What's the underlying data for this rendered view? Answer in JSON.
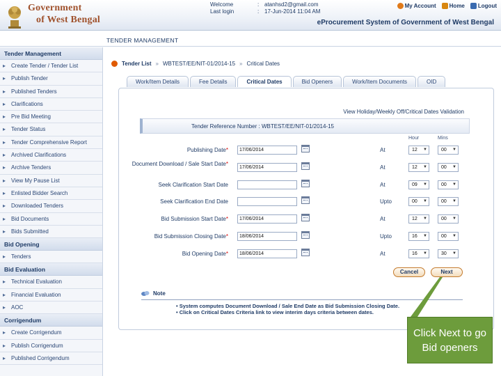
{
  "header": {
    "brand_line1": "Government",
    "brand_line2": "of West Bengal",
    "welcome_key": "Welcome",
    "welcome_sep": ":",
    "welcome_value": "atanhsd2@gmail.com",
    "lastlogin_key": "Last login",
    "lastlogin_sep": ":",
    "lastlogin_value": "17-Jun-2014 11:04 AM",
    "links": {
      "account": "My Account",
      "home": "Home",
      "logout": "Logout"
    },
    "system_title": "eProcurement System of Government of West Bengal"
  },
  "strip": {
    "title": "TENDER MANAGEMENT"
  },
  "sidebar": {
    "sections": [
      {
        "title": "Tender Management",
        "items": [
          "Create Tender / Tender List",
          "Publish Tender",
          "Published Tenders",
          "Clarifications",
          "Pre Bid Meeting",
          "Tender Status",
          "Tender Comprehensive Report",
          "Archived Clarifications",
          "Archive Tenders",
          "View My Pause List",
          "Enlisted Bidder Search",
          "Downloaded Tenders",
          "Bid Documents",
          "Bids Submitted"
        ]
      },
      {
        "title": "Bid Opening",
        "items": [
          "Tenders"
        ]
      },
      {
        "title": "Bid Evaluation",
        "items": [
          "Technical Evaluation",
          "Financial Evaluation",
          "AOC"
        ]
      },
      {
        "title": "Corrigendum",
        "items": [
          "Create Corrigendum",
          "Publish Corrigendum",
          "Published Corrigendum"
        ]
      }
    ]
  },
  "breadcrumb": {
    "item1": "Tender List",
    "sep": "»",
    "item2": "WBTEST/EE/NIT-01/2014-15",
    "item3": "Critical Dates"
  },
  "tabs": [
    "Work/Item Details",
    "Fee Details",
    "Critical Dates",
    "Bid Openers",
    "Work/Item Documents",
    "OID"
  ],
  "active_tab": "Critical Dates",
  "validation_link": "View Holiday/Weekly Off/Critical Dates Validation",
  "ref": {
    "label": "Tender Reference Number :",
    "value": "WBTEST/EE/NIT-01/2014-15"
  },
  "col_headers": {
    "hour": "Hour",
    "mins": "Mins"
  },
  "required_mark": "*",
  "date_rows": [
    {
      "label": "Publishing Date",
      "required": true,
      "date": "17/06/2014",
      "conj": "At",
      "hour": "12",
      "mins": "00"
    },
    {
      "label": "Document Download / Sale Start Date",
      "required": true,
      "date": "17/06/2014",
      "conj": "At",
      "hour": "12",
      "mins": "00"
    },
    {
      "label": "Seek Clarification Start Date",
      "required": false,
      "date": "",
      "conj": "At",
      "hour": "09",
      "mins": "00"
    },
    {
      "label": "Seek Clarification End Date",
      "required": false,
      "date": "",
      "conj": "Upto",
      "hour": "00",
      "mins": "00"
    },
    {
      "label": "Bid Submission Start Date",
      "required": true,
      "date": "17/06/2014",
      "conj": "At",
      "hour": "12",
      "mins": "00"
    },
    {
      "label": "Bid Submission Closing Date",
      "required": true,
      "date": "18/06/2014",
      "conj": "Upto",
      "hour": "16",
      "mins": "00"
    },
    {
      "label": "Bid Opening Date",
      "required": true,
      "date": "18/06/2014",
      "conj": "At",
      "hour": "16",
      "mins": "30"
    }
  ],
  "buttons": {
    "cancel": "Cancel",
    "next": "Next"
  },
  "note": {
    "title": "Note",
    "items": [
      "System computes Document Download / Sale End Date as Bid Submission Closing Date.",
      "Click on Critical Dates Criteria link to view interim days criteria between dates."
    ]
  },
  "callout": {
    "text": "Click Next to go Bid openers"
  },
  "colors": {
    "brand": "#a0522d",
    "accent": "#1f3b66",
    "callout": "#6d9c3c",
    "required": "#d40000"
  }
}
